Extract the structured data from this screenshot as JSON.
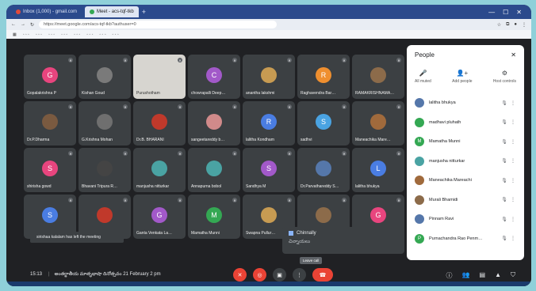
{
  "browser": {
    "tabs": [
      {
        "label": "Inbox (1,000) - gmail.com",
        "active": false
      },
      {
        "label": "Meet - acs-tqf-tkb",
        "active": true
      }
    ],
    "url": "https://meet.google.com/acs-tqf-tkb?authuser=0"
  },
  "tiles": [
    {
      "name": "Gopalakrishna P",
      "initial": "G",
      "color": "#e8457e"
    },
    {
      "name": "Kishan Goud",
      "initial": "",
      "color": "#7a7a7a"
    },
    {
      "name": "Purushotham",
      "initial": "",
      "color": "#d7d5d0",
      "photo": true
    },
    {
      "name": "chowrapalli Deep…",
      "initial": "C",
      "color": "#a259c9"
    },
    {
      "name": "anantha lakshmi",
      "initial": "",
      "color": "#c79b52"
    },
    {
      "name": "Raghavendra Bar…",
      "initial": "R",
      "color": "#ef8f2f"
    },
    {
      "name": "RAMAKRISHNAMA…",
      "initial": "",
      "color": "#8c6b4a"
    },
    {
      "name": "Dr.P.Dharma",
      "initial": "",
      "color": "#7a5a40"
    },
    {
      "name": "G.Krishna Mohan",
      "initial": "",
      "color": "#6f6f6f"
    },
    {
      "name": "Dr.B. BHARANI",
      "initial": "",
      "color": "#c0392b"
    },
    {
      "name": "sangeetareddy b…",
      "initial": "",
      "color": "#d18a8a"
    },
    {
      "name": "lalitha Kondham",
      "initial": "R",
      "color": "#4a7de2"
    },
    {
      "name": "sadhvi",
      "initial": "S",
      "color": "#4aa3e2"
    },
    {
      "name": "Maneachika Mare…",
      "initial": "",
      "color": "#a06a3c"
    },
    {
      "name": "shirisha gowd",
      "initial": "S",
      "color": "#e8457e"
    },
    {
      "name": "Bhavani Tripura R…",
      "initial": "",
      "color": "#444444"
    },
    {
      "name": "manjusha nitturkar",
      "initial": "",
      "color": "#4aa3a3"
    },
    {
      "name": "Annapurna bobol",
      "initial": "",
      "color": "#4aa3a3"
    },
    {
      "name": "Sandhya M",
      "initial": "S",
      "color": "#a259c9"
    },
    {
      "name": "Dr.Parvathareddy S…",
      "initial": "",
      "color": "#5577aa"
    },
    {
      "name": "lalitha bhukya",
      "initial": "L",
      "color": "#4a7de2"
    },
    {
      "name": "",
      "initial": "S",
      "color": "#4a7de2"
    },
    {
      "name": "",
      "initial": "",
      "color": "#c0392b"
    },
    {
      "name": "Ganta Venkata La…",
      "initial": "G",
      "color": "#a259c9"
    },
    {
      "name": "Mamatha Munni",
      "initial": "M",
      "color": "#34a853"
    },
    {
      "name": "Swapna Pullur…",
      "initial": "",
      "color": "#c79b52"
    },
    {
      "name": "",
      "initial": "",
      "color": "#8c6b4a"
    },
    {
      "name": "",
      "initial": "G",
      "color": "#e8457e"
    }
  ],
  "toast": "sirishaa kalalam has left the meeting",
  "chat_popup": {
    "sender": "Chinnally",
    "message": "చిన్నాయలు"
  },
  "tooltip": "Leave call",
  "bottombar": {
    "time": "15:13",
    "title": "అంతర్జాతీయ మాతృభాషా దినోత్సవం 21 February 2 pm"
  },
  "panel": {
    "title": "People",
    "close": "✕",
    "actions": [
      {
        "icon": "🎤",
        "label": "All muted"
      },
      {
        "icon": "👤+",
        "label": "Add people"
      },
      {
        "icon": "⚙",
        "label": "Host controls"
      }
    ],
    "people": [
      {
        "name": "lalitha bhukya",
        "initial": "",
        "color": "#5577aa"
      },
      {
        "name": "madhavi pluhath",
        "initial": "",
        "color": "#34a853"
      },
      {
        "name": "Mamatha Munni",
        "initial": "M",
        "color": "#34a853"
      },
      {
        "name": "manjusha nitturkar",
        "initial": "",
        "color": "#4aa3a3"
      },
      {
        "name": "Maneachika Mareachi",
        "initial": "",
        "color": "#a06a3c"
      },
      {
        "name": "Murali Bhamidi",
        "initial": "",
        "color": "#8c6b4a"
      },
      {
        "name": "Pinnam Ravi",
        "initial": "",
        "color": "#5577aa"
      },
      {
        "name": "Purnachandra Rao Penm…",
        "initial": "P",
        "color": "#34a853"
      }
    ]
  }
}
